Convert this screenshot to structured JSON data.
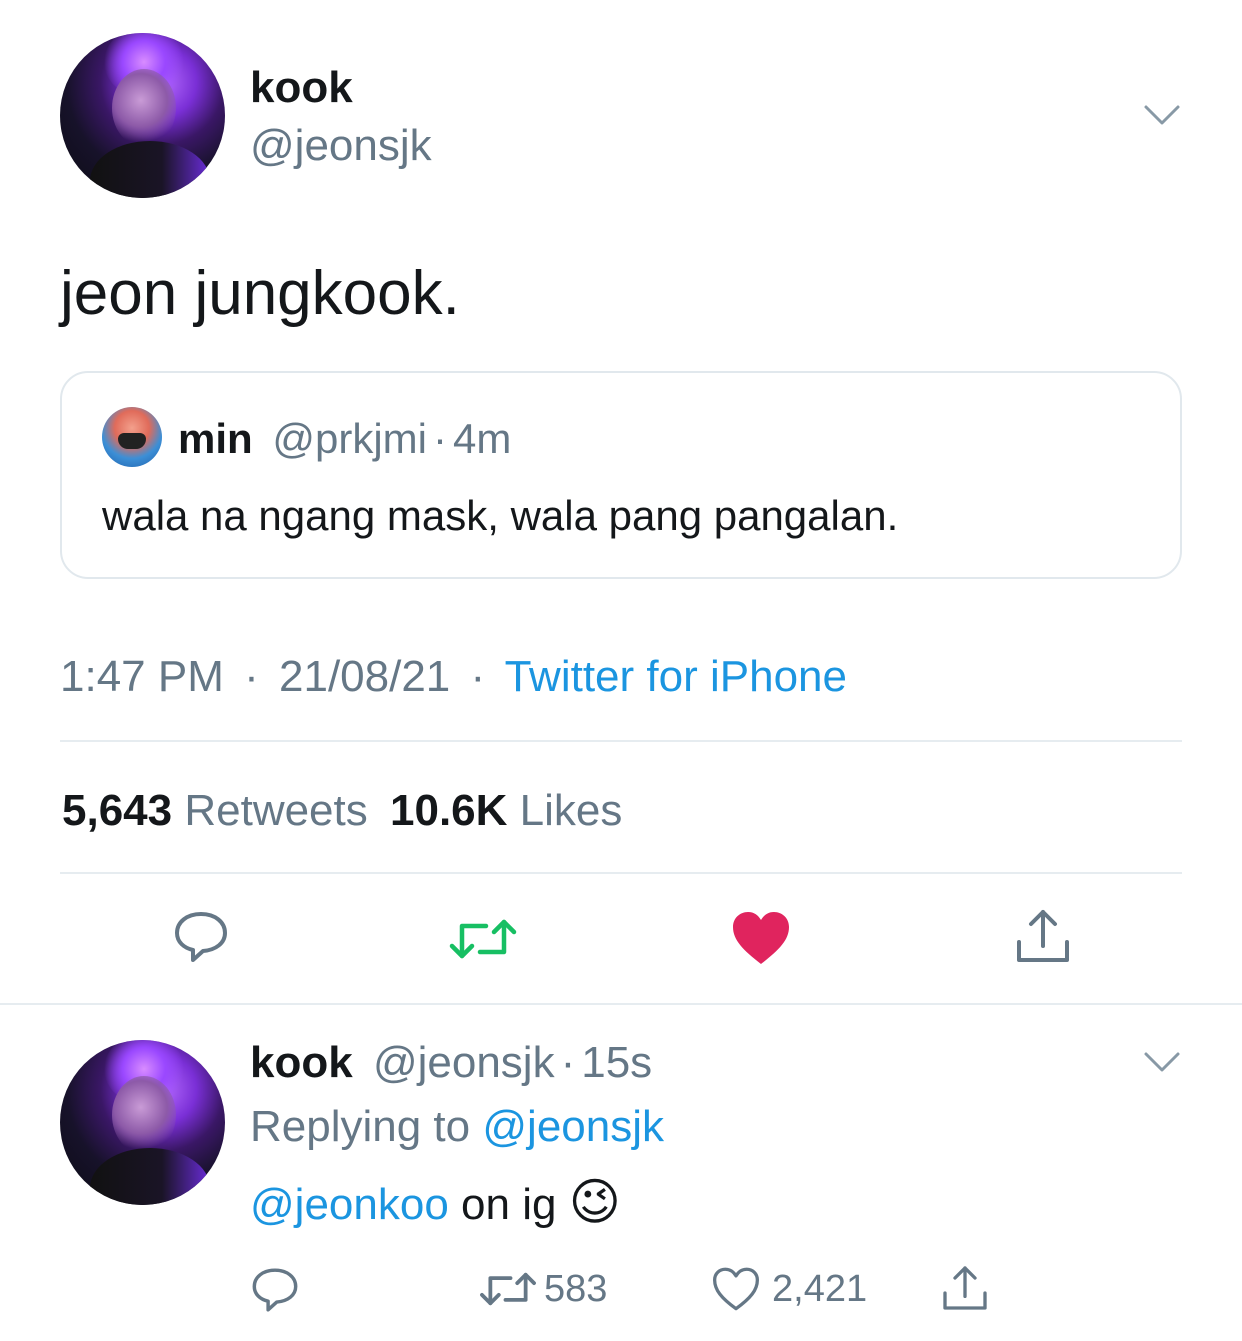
{
  "tweet": {
    "display_name": "kook",
    "handle": "@jeonsjk",
    "text": "jeon jungkook.",
    "quote": {
      "display_name": "min",
      "handle": "@prkjmi",
      "separator": "·",
      "age": "4m",
      "text": "wala na ngang mask, wala pang pangalan."
    },
    "time": "1:47 PM",
    "sep1": "·",
    "date": "21/08/21",
    "sep2": "·",
    "source": "Twitter for iPhone",
    "retweet_count": "5,643",
    "retweets_label": "Retweets",
    "like_count": "10.6K",
    "likes_label": "Likes"
  },
  "reply": {
    "display_name": "kook",
    "handle": "@jeonsjk",
    "separator": "·",
    "age": "15s",
    "replying_prefix": "Replying to",
    "replying_to": "@jeonsjk",
    "mention": "@jeonkoo",
    "text": "on ig",
    "emoji": "😉",
    "retweet_count": "583",
    "like_count": "2,421"
  },
  "icons": {
    "more": "chevron-down-icon",
    "reply": "reply-icon",
    "retweet": "retweet-icon",
    "like": "heart-icon",
    "share": "share-icon"
  },
  "colors": {
    "text": "#14171a",
    "muted": "#657786",
    "link": "#1b95e0",
    "retweet_active": "#17bf63",
    "like_active": "#e0245e",
    "divider": "#e6ecf0"
  }
}
